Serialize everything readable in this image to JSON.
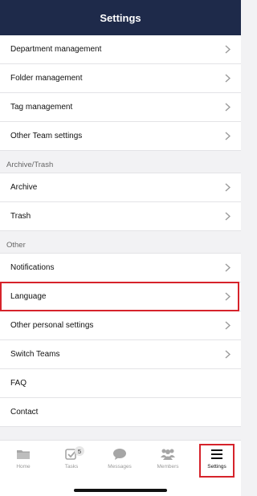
{
  "header": {
    "title": "Settings"
  },
  "sections": [
    {
      "label": "",
      "items": [
        {
          "label": "Department management",
          "chevron": true
        },
        {
          "label": "Folder management",
          "chevron": true
        },
        {
          "label": "Tag management",
          "chevron": true
        },
        {
          "label": "Other Team settings",
          "chevron": true
        }
      ]
    },
    {
      "label": "Archive/Trash",
      "items": [
        {
          "label": "Archive",
          "chevron": true
        },
        {
          "label": "Trash",
          "chevron": true
        }
      ]
    },
    {
      "label": "Other",
      "items": [
        {
          "label": "Notifications",
          "chevron": true
        },
        {
          "label": "Language",
          "chevron": true,
          "highlighted": true
        },
        {
          "label": "Other personal settings",
          "chevron": true
        },
        {
          "label": "Switch Teams",
          "chevron": true
        },
        {
          "label": "FAQ",
          "chevron": false
        },
        {
          "label": "Contact",
          "chevron": false
        }
      ]
    }
  ],
  "tabbar": {
    "tabs": [
      {
        "label": "Home",
        "icon": "folder-icon",
        "active": false
      },
      {
        "label": "Tasks",
        "icon": "checkbox-icon",
        "badge": "5",
        "active": false
      },
      {
        "label": "Messages",
        "icon": "chat-bubble-icon",
        "active": false
      },
      {
        "label": "Members",
        "icon": "people-icon",
        "active": false
      },
      {
        "label": "Settings",
        "icon": "menu-icon",
        "active": true
      }
    ]
  },
  "colors": {
    "header_bg": "#1e2a4a",
    "highlight_border": "#d6232b"
  }
}
